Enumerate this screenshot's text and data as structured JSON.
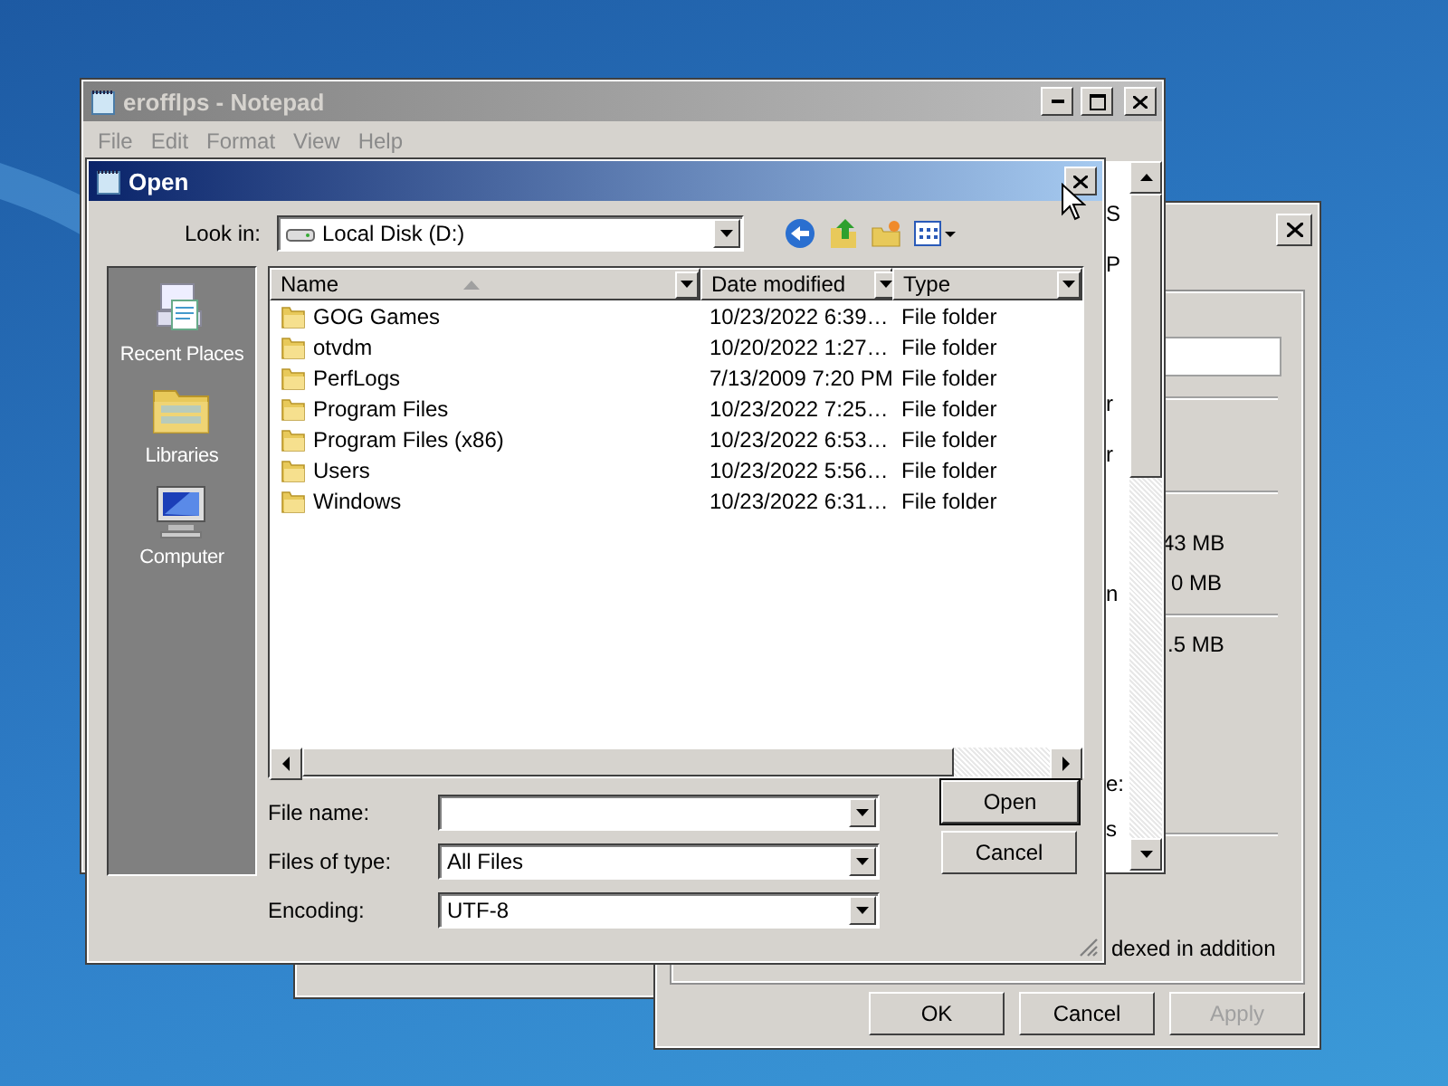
{
  "notepad": {
    "title": "erofflps - Notepad",
    "menu": [
      "File",
      "Edit",
      "Format",
      "View",
      "Help"
    ],
    "text_fragments": [
      "S",
      "P",
      "r",
      "r",
      "n",
      "e:",
      "s"
    ]
  },
  "properties": {
    "readings": [
      "43 MB",
      "0 MB",
      ".5 MB"
    ],
    "note": "dexed in addition",
    "buttons": [
      {
        "label": "OK",
        "disabled": false
      },
      {
        "label": "Cancel",
        "disabled": false
      },
      {
        "label": "Apply",
        "disabled": true
      }
    ]
  },
  "open_dialog": {
    "title": "Open",
    "look_in_label": "Look in:",
    "look_in_value": "Local Disk (D:)",
    "places": [
      {
        "label": "Recent Places",
        "kind": "recent"
      },
      {
        "label": "Libraries",
        "kind": "libraries"
      },
      {
        "label": "Computer",
        "kind": "computer"
      }
    ],
    "columns": [
      {
        "label": "Name",
        "sorted": true
      },
      {
        "label": "Date modified",
        "sorted": false
      },
      {
        "label": "Type",
        "sorted": false
      }
    ],
    "rows": [
      {
        "name": "GOG Games",
        "date": "10/23/2022 6:39…",
        "type": "File folder"
      },
      {
        "name": "otvdm",
        "date": "10/20/2022 1:27…",
        "type": "File folder"
      },
      {
        "name": "PerfLogs",
        "date": "7/13/2009 7:20 PM",
        "type": "File folder"
      },
      {
        "name": "Program Files",
        "date": "10/23/2022 7:25…",
        "type": "File folder"
      },
      {
        "name": "Program Files (x86)",
        "date": "10/23/2022 6:53…",
        "type": "File folder"
      },
      {
        "name": "Users",
        "date": "10/23/2022 5:56…",
        "type": "File folder"
      },
      {
        "name": "Windows",
        "date": "10/23/2022 6:31…",
        "type": "File folder"
      }
    ],
    "fields": [
      {
        "label": "File name:"
      },
      {
        "label": "Files of type:",
        "value": "All Files"
      },
      {
        "label": "Encoding:",
        "value": "UTF-8"
      }
    ],
    "buttons": [
      {
        "label": "Open",
        "default": true
      },
      {
        "label": "Cancel",
        "default": false
      }
    ]
  }
}
